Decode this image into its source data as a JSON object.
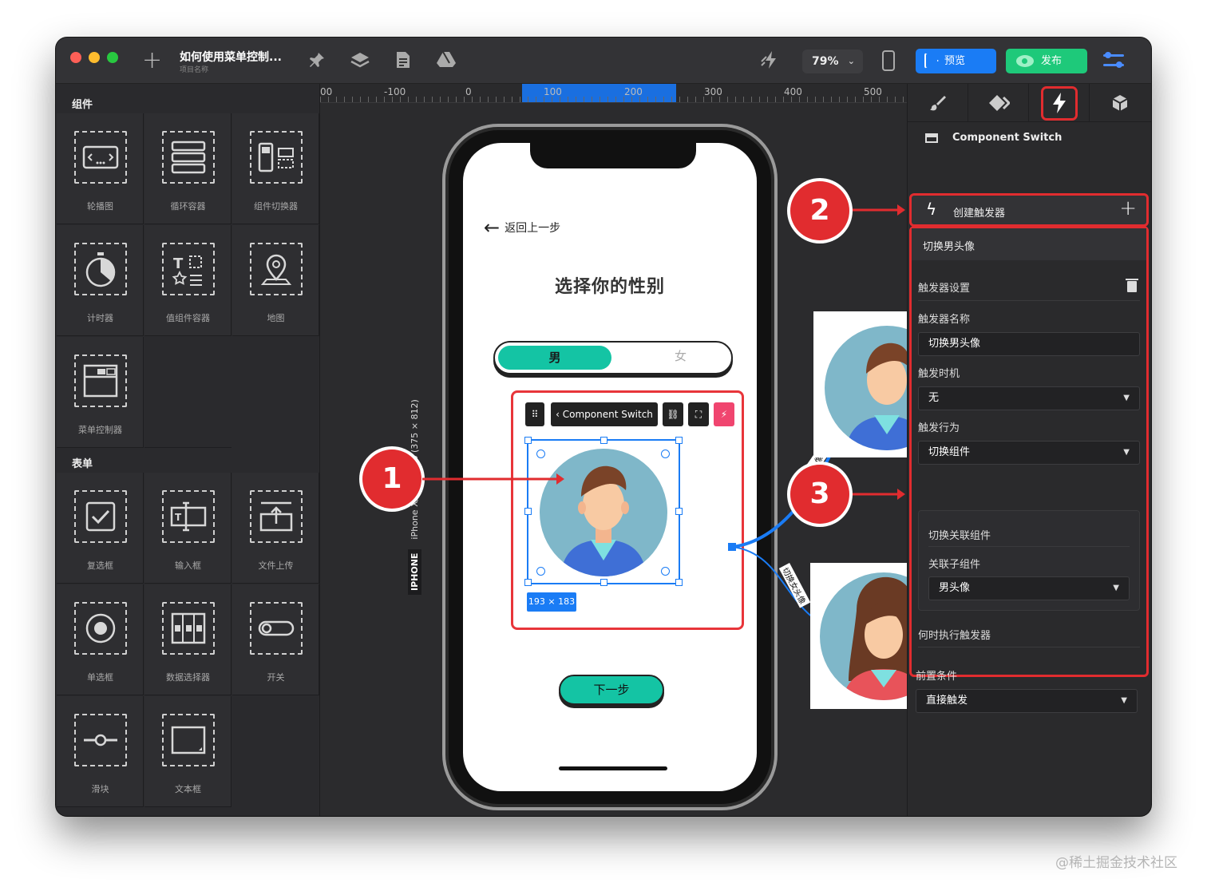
{
  "titlebar": {
    "project_title": "如何使用菜单控制...",
    "project_subtitle": "项目名称",
    "zoom": "79%",
    "preview_label": "预览",
    "publish_label": "发布"
  },
  "left_panel": {
    "section_components": "组件",
    "section_form": "表单",
    "components": [
      "轮播图",
      "循环容器",
      "组件切换器",
      "计时器",
      "值组件容器",
      "地图",
      "菜单控制器"
    ],
    "form_items": [
      "复选框",
      "输入框",
      "文件上传",
      "单选框",
      "数据选择器",
      "开关",
      "滑块",
      "文本框"
    ]
  },
  "ruler": {
    "ticks": [
      "00",
      "-100",
      "0",
      "100",
      "200",
      "300",
      "400",
      "500"
    ]
  },
  "phone": {
    "device_tag": "IPHONE",
    "device_label": "iPhone X/XS/11 Pro (375 × 812)",
    "back_label": "返回上一步",
    "headline": "选择你的性别",
    "option_male": "男",
    "option_female": "女",
    "toolbar_component": "Component Switch",
    "size_badge": "193 × 183",
    "next_label": "下一步"
  },
  "connectors": {
    "top_label": "切换男头像",
    "bottom_label": "切换女头像"
  },
  "callouts": [
    "1",
    "2",
    "3"
  ],
  "right_panel": {
    "component_name": "Component Switch",
    "create_trigger": "创建触发器",
    "trigger_header": "切换男头像",
    "trigger_settings": "触发器设置",
    "trigger_name_label": "触发器名称",
    "trigger_name_value": "切换男头像",
    "trigger_timing_label": "触发时机",
    "trigger_timing_value": "无",
    "trigger_action_label": "触发行为",
    "trigger_action_value": "切换组件",
    "switch_related_label": "切换关联组件",
    "child_component_label": "关联子组件",
    "child_component_value": "男头像",
    "when_execute_label": "何时执行触发器",
    "precondition_label": "前置条件",
    "precondition_value": "直接触发"
  },
  "colors": {
    "accent_blue": "#1a7cf5",
    "publish_green": "#1ec97a",
    "teal": "#14c4a4",
    "highlight_red": "#e12c2f"
  },
  "watermark": "@稀土掘金技术社区"
}
